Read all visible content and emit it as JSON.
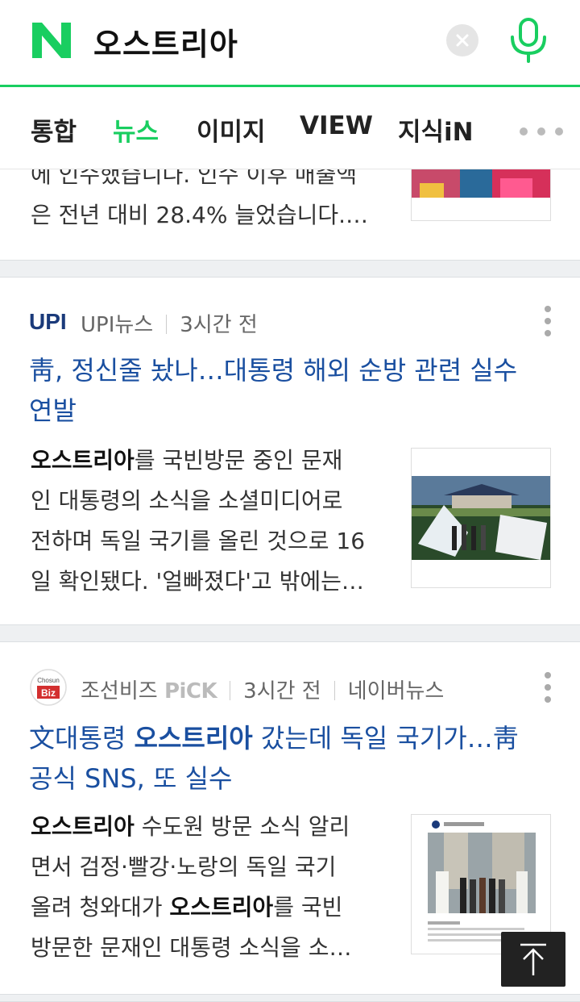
{
  "search": {
    "query": "오스트리아"
  },
  "tabs": [
    {
      "label": "통합",
      "active": false
    },
    {
      "label": "뉴스",
      "active": true
    },
    {
      "label": "이미지",
      "active": false
    },
    {
      "label": "VIEW",
      "active": false
    },
    {
      "label": "지식iN",
      "active": false
    }
  ],
  "colors": {
    "brand": "#19ce60",
    "title_link": "#1a4fa0"
  },
  "icons": [
    "naver-logo-icon",
    "clear-icon",
    "mic-icon",
    "more-dots-icon",
    "kebab-icon",
    "back-to-top-icon"
  ],
  "articles": [
    {
      "snippet_line1": "에 인수했습니다. 인수 이후 매출액",
      "snippet_line2": "은 전년 대비 28.4% 늘었습니다.…"
    },
    {
      "press_logo_text": "UPI",
      "press": "UPI뉴스",
      "time": "3시간 전",
      "title_line1": "靑, 정신줄 놨나…대통령 해외 순방 관련 실수",
      "title_line2": "연발",
      "snippet_highlight": "오스트리아",
      "snippet_line1_rest": "를 국빈방문 중인 문재",
      "snippet_line2": "인 대통령의 소식을 소셜미디어로",
      "snippet_line3": "전하며 독일 국기를 올린 것으로 16",
      "snippet_line4": "일 확인됐다. '얼빠졌다'고 밖에는…"
    },
    {
      "press_logo_top": "Chosun",
      "press_logo_bottom": "Biz",
      "press": "조선비즈",
      "pick": "PiCK",
      "time": "3시간 전",
      "source": "네이버뉴스",
      "title_pre": "文대통령 ",
      "title_highlight": "오스트리아",
      "title_post": " 갔는데 독일 국기가…靑",
      "title_line2": "공식 SNS, 또 실수",
      "snippet_line1_highlight": "오스트리아",
      "snippet_line1_rest": " 수도원 방문 소식 알리",
      "snippet_line2": "면서 검정·빨강·노랑의 독일 국기",
      "snippet_line3_pre": "올려 청와대가 ",
      "snippet_line3_highlight": "오스트리아",
      "snippet_line3_post": "를 국빈",
      "snippet_line4": "방문한 문재인 대통령 소식을 소…"
    }
  ]
}
